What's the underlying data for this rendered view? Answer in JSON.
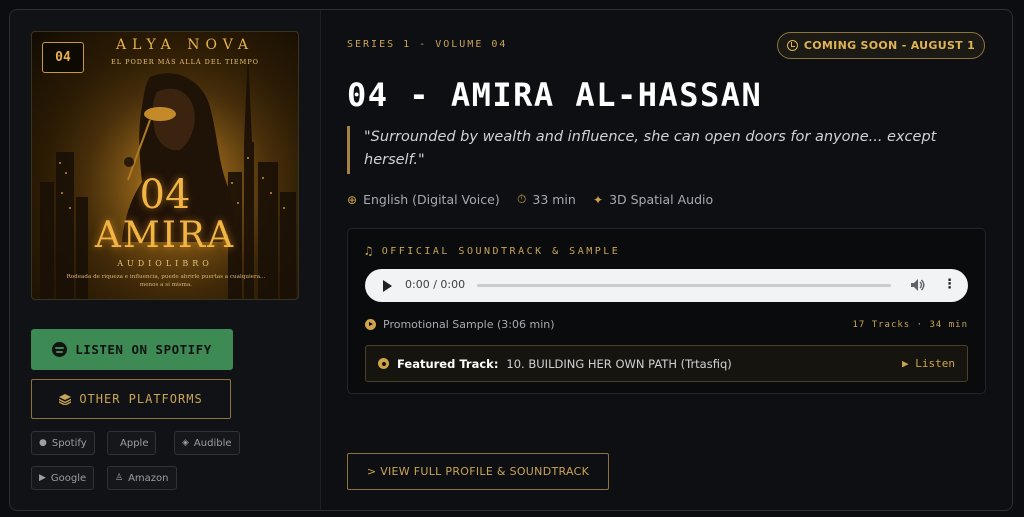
{
  "cover": {
    "badge": "04",
    "author": "ALYA NOVA",
    "tagline": "EL PODER MÁS ALLÁ DEL TIEMPO",
    "number": "04",
    "name": "AMIRA",
    "format": "AUDIOLIBRO",
    "blurb": "Rodeada de riqueza e influencia, puede abrirle puertas a cualquiera... menos a sí misma."
  },
  "left": {
    "spotify_button": "LISTEN ON SPOTIFY",
    "platforms_button": "OTHER PLATFORMS",
    "chips": [
      {
        "label": "Spotify",
        "icon": "spotify-icon"
      },
      {
        "label": "Apple",
        "icon": "apple-icon"
      },
      {
        "label": "Audible",
        "icon": "audible-icon"
      },
      {
        "label": "Google",
        "icon": "google-play-icon"
      },
      {
        "label": "Amazon",
        "icon": "amazon-icon"
      }
    ]
  },
  "header": {
    "series": "SERIES 1 - VOLUME 04",
    "status": "COMING SOON - AUGUST 1",
    "title": "04 - AMIRA AL-HASSAN",
    "quote": "\"Surrounded by wealth and influence, she can open doors for anyone... except herself.\""
  },
  "meta": {
    "language": "English (Digital Voice)",
    "duration": "33 min",
    "audio": "3D Spatial Audio"
  },
  "soundtrack": {
    "heading": "OFFICIAL SOUNDTRACK & SAMPLE",
    "player_time": "0:00 / 0:00",
    "promo": "Promotional Sample (3:06 min)",
    "tracks": "17 Tracks · 34 min",
    "featured_label": "Featured Track:",
    "featured_value": "10. BUILDING HER OWN PATH (Trtasfiq)",
    "listen": "▶ Listen"
  },
  "view_button": "> VIEW FULL PROFILE & SOUNDTRACK",
  "colors": {
    "accent_gold": "#c9a455",
    "spotify_green": "#3e8a55",
    "background": "#0d0f12"
  }
}
